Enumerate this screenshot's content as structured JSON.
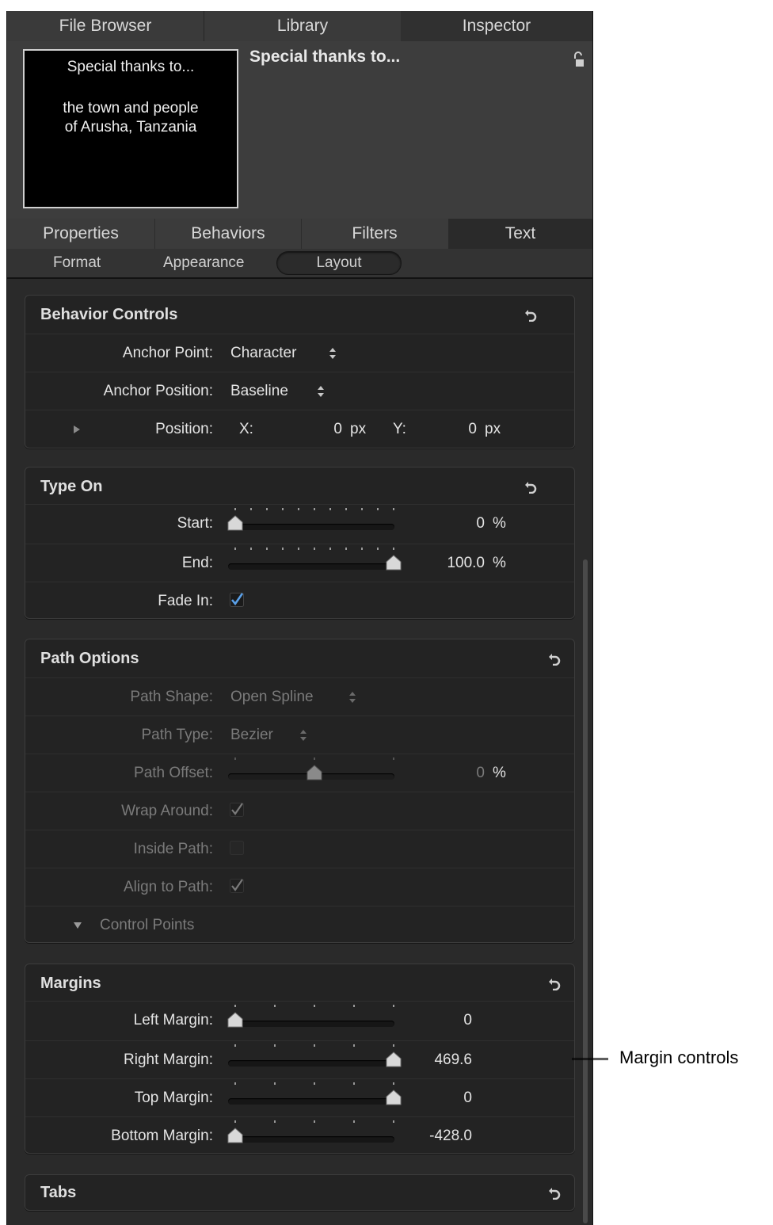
{
  "top_tabs": [
    {
      "label": "File Browser"
    },
    {
      "label": "Library"
    },
    {
      "label": "Inspector"
    }
  ],
  "preview": {
    "thumbnail_lines": [
      "Special thanks to...",
      "the town and people",
      "of Arusha, Tanzania"
    ],
    "object_title": "Special thanks to..."
  },
  "inspector_tabs": [
    {
      "label": "Properties"
    },
    {
      "label": "Behaviors"
    },
    {
      "label": "Filters"
    },
    {
      "label": "Text"
    }
  ],
  "sub_tabs": [
    {
      "label": "Format"
    },
    {
      "label": "Appearance"
    },
    {
      "label": "Layout"
    }
  ],
  "behavior_controls": {
    "title": "Behavior Controls",
    "anchor_point": {
      "label": "Anchor Point:",
      "value": "Character"
    },
    "anchor_position": {
      "label": "Anchor Position:",
      "value": "Baseline"
    },
    "position": {
      "label": "Position:",
      "x_label": "X:",
      "x_value": "0",
      "x_unit": "px",
      "y_label": "Y:",
      "y_value": "0",
      "y_unit": "px"
    }
  },
  "type_on": {
    "title": "Type On",
    "start": {
      "label": "Start:",
      "value": "0",
      "unit": "%",
      "fraction": 0.0
    },
    "end": {
      "label": "End:",
      "value": "100.0",
      "unit": "%",
      "fraction": 1.0
    },
    "fade_in": {
      "label": "Fade In:",
      "checked": true
    }
  },
  "path_options": {
    "title": "Path Options",
    "path_shape": {
      "label": "Path Shape:",
      "value": "Open Spline"
    },
    "path_type": {
      "label": "Path Type:",
      "value": "Bezier"
    },
    "path_offset": {
      "label": "Path Offset:",
      "value": "0",
      "unit": "%",
      "fraction": 0.5
    },
    "wrap_around": {
      "label": "Wrap Around:",
      "checked": true
    },
    "inside_path": {
      "label": "Inside Path:",
      "checked": false
    },
    "align_to_path": {
      "label": "Align to Path:",
      "checked": true
    },
    "control_points": {
      "label": "Control Points"
    }
  },
  "margins": {
    "title": "Margins",
    "left": {
      "label": "Left Margin:",
      "value": "0",
      "fraction": 0.0
    },
    "right": {
      "label": "Right Margin:",
      "value": "469.6",
      "fraction": 1.0
    },
    "top": {
      "label": "Top Margin:",
      "value": "0",
      "fraction": 1.0
    },
    "bottom": {
      "label": "Bottom Margin:",
      "value": "-428.0",
      "fraction": 0.0
    }
  },
  "tabs_group": {
    "title": "Tabs"
  },
  "callout": {
    "text": "Margin controls"
  },
  "colors": {
    "panel": "#2a2a2a",
    "group": "#232323",
    "check": "#5aa0e8"
  }
}
